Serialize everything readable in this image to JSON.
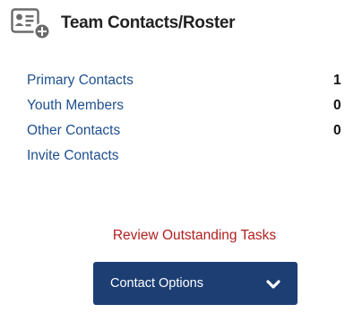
{
  "header": {
    "title": "Team Contacts/Roster",
    "icon": "contact-card-add-icon"
  },
  "contacts": [
    {
      "label": "Primary Contacts",
      "count": "1"
    },
    {
      "label": "Youth Members",
      "count": "0"
    },
    {
      "label": "Other Contacts",
      "count": "0"
    },
    {
      "label": "Invite Contacts",
      "count": ""
    }
  ],
  "review_link": "Review Outstanding Tasks",
  "options_button": {
    "label": "Contact Options",
    "icon": "chevron-down-icon"
  },
  "colors": {
    "link_blue": "#1f4f8f",
    "review_red": "#b21e1e",
    "button_navy": "#1c3e73"
  }
}
